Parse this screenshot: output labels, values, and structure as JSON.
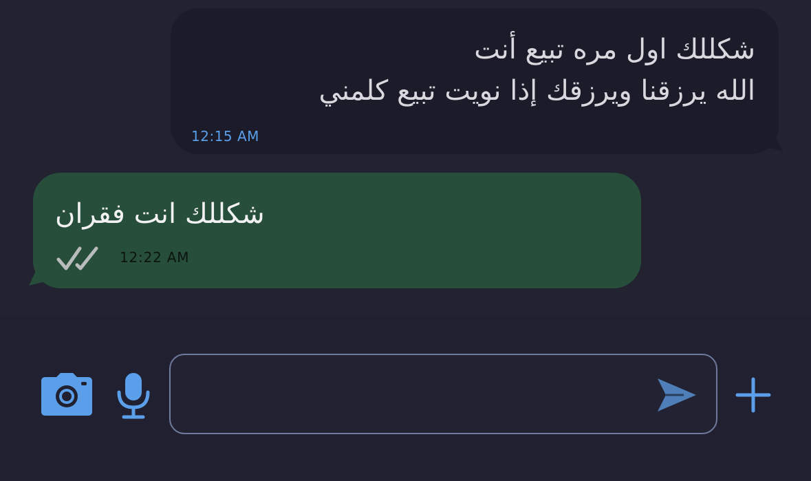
{
  "messages": [
    {
      "direction": "incoming",
      "lines": [
        "شكللك اول مره تبيع أنت",
        "الله يرزقنا ويرزقك إذا نويت تبيع كلمني"
      ],
      "time": "12:15 AM"
    },
    {
      "direction": "outgoing",
      "text": "شكللك انت فقران",
      "time": "12:22 AM",
      "status": "read-double-check"
    }
  ],
  "composer": {
    "input_value": "",
    "placeholder": "",
    "icons": [
      "camera-icon",
      "microphone-icon",
      "send-icon",
      "plus-icon"
    ]
  },
  "colors": {
    "background": "#222231",
    "incoming_bubble": "#1b1b29",
    "outgoing_bubble": "#264e3a",
    "accent": "#5b9fea",
    "input_border": "#6f7b9d"
  }
}
